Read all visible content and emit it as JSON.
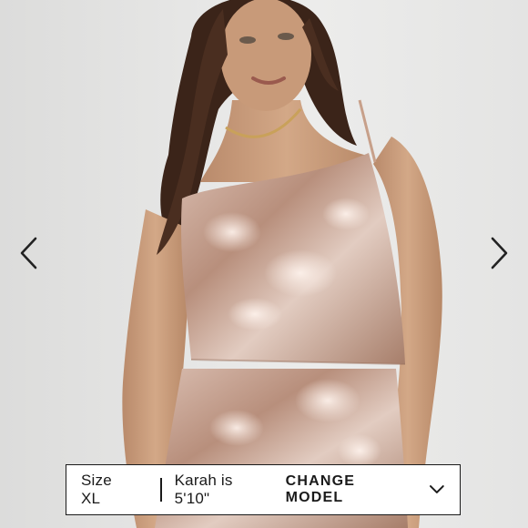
{
  "viewer": {
    "prev_icon": "chevron-left-icon",
    "next_icon": "chevron-right-icon"
  },
  "model_bar": {
    "size_label": "Size XL",
    "model_info": "Karah is 5'10\"",
    "change_label": "CHANGE MODEL",
    "dropdown_icon": "chevron-down-icon"
  },
  "colors": {
    "bar_border": "#1a1a1a",
    "bar_background": "#ffffff",
    "backdrop": "#e6e6e5",
    "sequin": "#c9a896"
  }
}
